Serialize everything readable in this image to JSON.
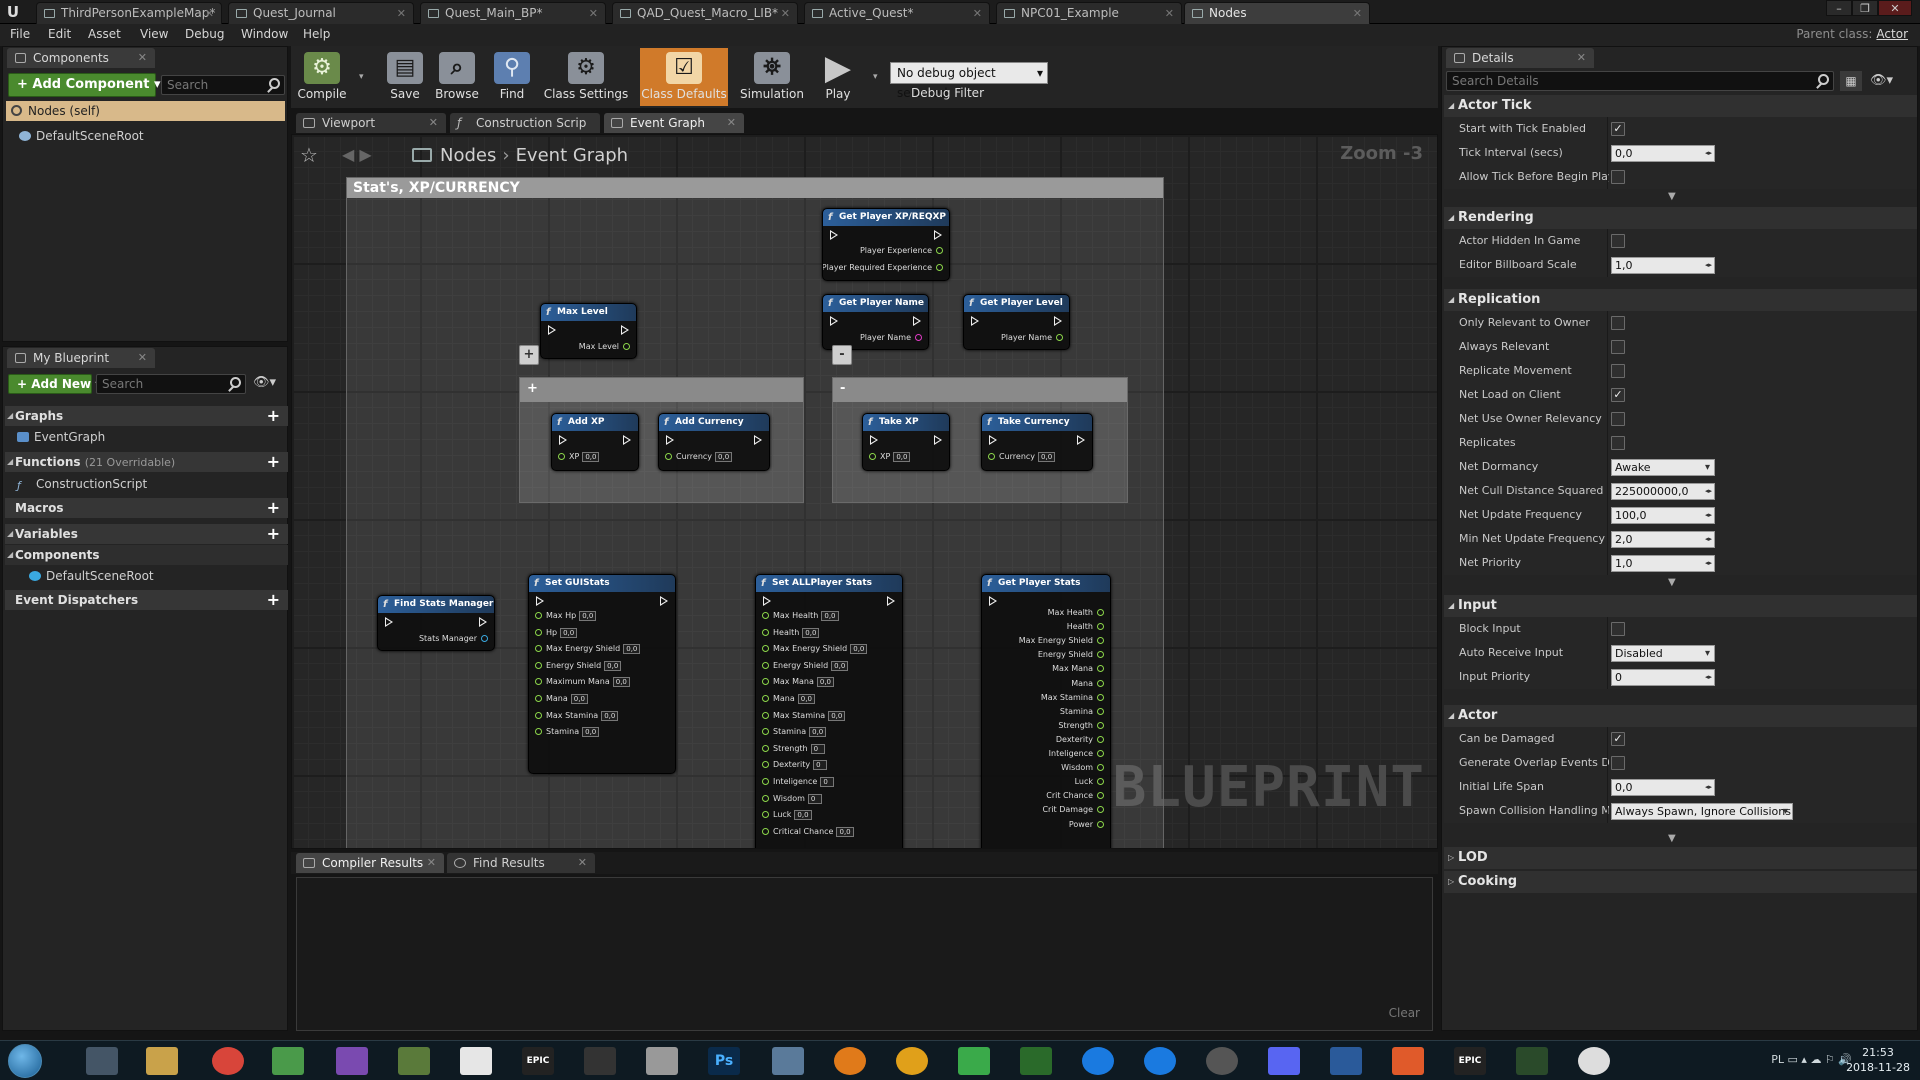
{
  "window": {
    "tabs": [
      {
        "label": "ThirdPersonExampleMap*"
      },
      {
        "label": "Quest_Journal"
      },
      {
        "label": "Quest_Main_BP*"
      },
      {
        "label": "QAD_Quest_Macro_LIB*"
      },
      {
        "label": "Active_Quest*"
      },
      {
        "label": "NPC01_Example"
      },
      {
        "label": "Nodes"
      }
    ],
    "controls": {
      "minimize": "–",
      "maximize": "❐",
      "close": "✕"
    }
  },
  "menu": {
    "items": [
      "File",
      "Edit",
      "Asset",
      "View",
      "Debug",
      "Window",
      "Help"
    ],
    "parent_class_label": "Parent class:",
    "parent_class_value": "Actor"
  },
  "components_panel": {
    "tab": "Components",
    "add_button": "+ Add Component ▾",
    "search_placeholder": "Search",
    "self_item": "Nodes (self)",
    "root_item": "DefaultSceneRoot"
  },
  "my_blueprint": {
    "tab": "My Blueprint",
    "add_button": "+ Add New ▾",
    "search_placeholder": "Search",
    "graphs_label": "Graphs",
    "graph_item": "EventGraph",
    "functions_label": "Functions",
    "functions_count": "(21 Overridable)",
    "function_item": "ConstructionScript",
    "macros_label": "Macros",
    "variables_label": "Variables",
    "components_label": "Components",
    "component_item": "DefaultSceneRoot",
    "dispatchers_label": "Event Dispatchers"
  },
  "toolbar": {
    "compile": "Compile",
    "save": "Save",
    "browse": "Browse",
    "find": "Find",
    "class_settings": "Class Settings",
    "class_defaults": "Class Defaults",
    "simulation": "Simulation",
    "play": "Play",
    "debug_select": "No debug object selected",
    "debug_filter": "Debug Filter"
  },
  "editor_tabs": {
    "viewport": "Viewport",
    "construction": "Construction Scrip",
    "event_graph": "Event Graph"
  },
  "graph": {
    "breadcrumb_root": "Nodes",
    "breadcrumb_graph": "Event Graph",
    "zoom": "Zoom -3",
    "watermark": "BLUEPRINT",
    "comment_title": "Stat's, XP/CURRENCY",
    "plus_box_title": "+",
    "minus_box_title": "-",
    "plus_button": "+",
    "minus_button": "-",
    "nodes": {
      "get_xp": {
        "title": "Get Player XP/REQXP",
        "pin1": "Player Experience",
        "pin2": "Player Required Experience"
      },
      "get_name": {
        "title": "Get Player Name",
        "pin1": "Player Name"
      },
      "get_level": {
        "title": "Get Player Level",
        "pin1": "Player Name"
      },
      "max_level": {
        "title": "Max Level",
        "pin1": "Max Level"
      },
      "add_xp": {
        "title": "Add XP",
        "pin1": "XP",
        "val": "0,0"
      },
      "add_currency": {
        "title": "Add Currency",
        "pin1": "Currency",
        "val": "0,0"
      },
      "take_xp": {
        "title": "Take XP",
        "pin1": "XP",
        "val": "0,0"
      },
      "take_currency": {
        "title": "Take Currency",
        "pin1": "Currency",
        "val": "0,0"
      },
      "find_stats": {
        "title": "Find Stats Manager",
        "pin1": "Stats Manager"
      },
      "set_gui_stats": {
        "title": "Set GUIStats",
        "pins": [
          {
            "label": "Max Hp",
            "val": "0,0"
          },
          {
            "label": "Hp",
            "val": "0,0"
          },
          {
            "label": "Max Energy Shield",
            "val": "0,0"
          },
          {
            "label": "Energy Shield",
            "val": "0,0"
          },
          {
            "label": "Maximum Mana",
            "val": "0,0"
          },
          {
            "label": "Mana",
            "val": "0,0"
          },
          {
            "label": "Max Stamina",
            "val": "0,0"
          },
          {
            "label": "Stamina",
            "val": "0,0"
          }
        ]
      },
      "set_all_stats": {
        "title": "Set ALLPlayer Stats",
        "pins": [
          {
            "label": "Max Health",
            "val": "0,0"
          },
          {
            "label": "Health",
            "val": "0,0"
          },
          {
            "label": "Max Energy Shield",
            "val": "0,0"
          },
          {
            "label": "Energy Shield",
            "val": "0,0"
          },
          {
            "label": "Max Mana",
            "val": "0,0"
          },
          {
            "label": "Mana",
            "val": "0,0"
          },
          {
            "label": "Max Stamina",
            "val": "0,0"
          },
          {
            "label": "Stamina",
            "val": "0,0"
          },
          {
            "label": "Strength",
            "val": "0"
          },
          {
            "label": "Dexterity",
            "val": "0"
          },
          {
            "label": "Inteligence",
            "val": "0"
          },
          {
            "label": "Wisdom",
            "val": "0"
          },
          {
            "label": "Luck",
            "val": "0,0"
          },
          {
            "label": "Critical Chance",
            "val": "0,0"
          }
        ]
      },
      "get_stats": {
        "title": "Get Player Stats",
        "pins": [
          "Max Health",
          "Health",
          "Max Energy Shield",
          "Energy Shield",
          "Max Mana",
          "Mana",
          "Max Stamina",
          "Stamina",
          "Strength",
          "Dexterity",
          "Inteligence",
          "Wisdom",
          "Luck",
          "Crit Chance",
          "Crit Damage",
          "Power"
        ]
      }
    }
  },
  "bottom": {
    "compiler_results": "Compiler Results",
    "find_results": "Find Results",
    "clear": "Clear"
  },
  "details": {
    "tab": "Details",
    "search_placeholder": "Search Details",
    "actor_tick": {
      "title": "Actor Tick",
      "start_with_tick": "Start with Tick Enabled",
      "tick_interval": "Tick Interval (secs)",
      "tick_interval_val": "0,0",
      "allow_tick_before_play": "Allow Tick Before Begin Play"
    },
    "rendering": {
      "title": "Rendering",
      "hidden": "Actor Hidden In Game",
      "billboard": "Editor Billboard Scale",
      "billboard_val": "1,0"
    },
    "replication": {
      "title": "Replication",
      "only_relevant": "Only Relevant to Owner",
      "always_relevant": "Always Relevant",
      "replicate_movement": "Replicate Movement",
      "net_load": "Net Load on Client",
      "net_use_owner": "Net Use Owner Relevancy",
      "replicates": "Replicates",
      "net_dormancy": "Net Dormancy",
      "net_dormancy_val": "Awake",
      "net_cull": "Net Cull Distance Squared",
      "net_cull_val": "225000000,0",
      "net_update": "Net Update Frequency",
      "net_update_val": "100,0",
      "min_net_update": "Min Net Update Frequency",
      "min_net_update_val": "2,0",
      "net_priority": "Net Priority",
      "net_priority_val": "1,0"
    },
    "input": {
      "title": "Input",
      "block_input": "Block Input",
      "auto_receive": "Auto Receive Input",
      "auto_receive_val": "Disabled",
      "input_priority": "Input Priority",
      "input_priority_val": "0"
    },
    "actor": {
      "title": "Actor",
      "can_be_damaged": "Can be Damaged",
      "generate_overlap": "Generate Overlap Events Dur",
      "initial_life_span": "Initial Life Span",
      "initial_life_span_val": "0,0",
      "spawn_collision": "Spawn Collision Handling Me",
      "spawn_collision_val": "Always Spawn, Ignore Collisions"
    },
    "lod": "LOD",
    "cooking": "Cooking"
  },
  "taskbar": {
    "tray_lang": "PL",
    "time": "21:53",
    "date": "2018-11-28",
    "apps": [
      "EPIC",
      "Ps",
      "EPIC"
    ]
  }
}
